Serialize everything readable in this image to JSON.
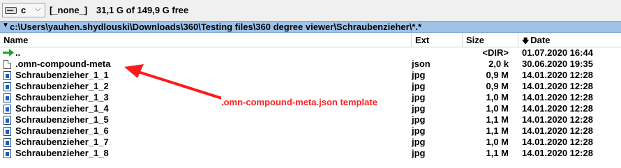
{
  "drive": {
    "letter": "c",
    "label": "[_none_]",
    "space": "31,1 G of 149,9 G free"
  },
  "path": "c:\\Users\\yauhen.shydlouski\\Downloads\\360\\Testing files\\360 degree viewer\\Schraubenzieher\\*.*",
  "columns": {
    "name": "Name",
    "ext": "Ext",
    "size": "Size",
    "date": "Date"
  },
  "rows": [
    {
      "name": "..",
      "ext": "",
      "size": "<DIR>",
      "date": "01.07.2020 16:44",
      "icon": "up-arrow-icon"
    },
    {
      "name": ".omn-compound-meta",
      "ext": "json",
      "size": "2,0 k",
      "date": "30.06.2020 19:35",
      "icon": "document-icon"
    },
    {
      "name": "Schraubenzieher_1_1",
      "ext": "jpg",
      "size": "0,9 M",
      "date": "14.01.2020 12:28",
      "icon": "image-file-icon"
    },
    {
      "name": "Schraubenzieher_1_2",
      "ext": "jpg",
      "size": "0,9 M",
      "date": "14.01.2020 12:28",
      "icon": "image-file-icon"
    },
    {
      "name": "Schraubenzieher_1_3",
      "ext": "jpg",
      "size": "1,0 M",
      "date": "14.01.2020 12:28",
      "icon": "image-file-icon"
    },
    {
      "name": "Schraubenzieher_1_4",
      "ext": "jpg",
      "size": "1,0 M",
      "date": "14.01.2020 12:28",
      "icon": "image-file-icon"
    },
    {
      "name": "Schraubenzieher_1_5",
      "ext": "jpg",
      "size": "1,1 M",
      "date": "14.01.2020 12:28",
      "icon": "image-file-icon"
    },
    {
      "name": "Schraubenzieher_1_6",
      "ext": "jpg",
      "size": "1,1 M",
      "date": "14.01.2020 12:28",
      "icon": "image-file-icon"
    },
    {
      "name": "Schraubenzieher_1_7",
      "ext": "jpg",
      "size": "1,0 M",
      "date": "14.01.2020 12:28",
      "icon": "image-file-icon"
    },
    {
      "name": "Schraubenzieher_1_8",
      "ext": "jpg",
      "size": "1,1 M",
      "date": "14.01.2020 12:28",
      "icon": "image-file-icon"
    }
  ],
  "annotation": {
    "text": ".omn-compound-meta.json template",
    "color": "#ff2020"
  },
  "colors": {
    "path_bar": "#9fc3e8",
    "up_arrow": "#22a022",
    "image_icon": "#1f5fb5"
  }
}
